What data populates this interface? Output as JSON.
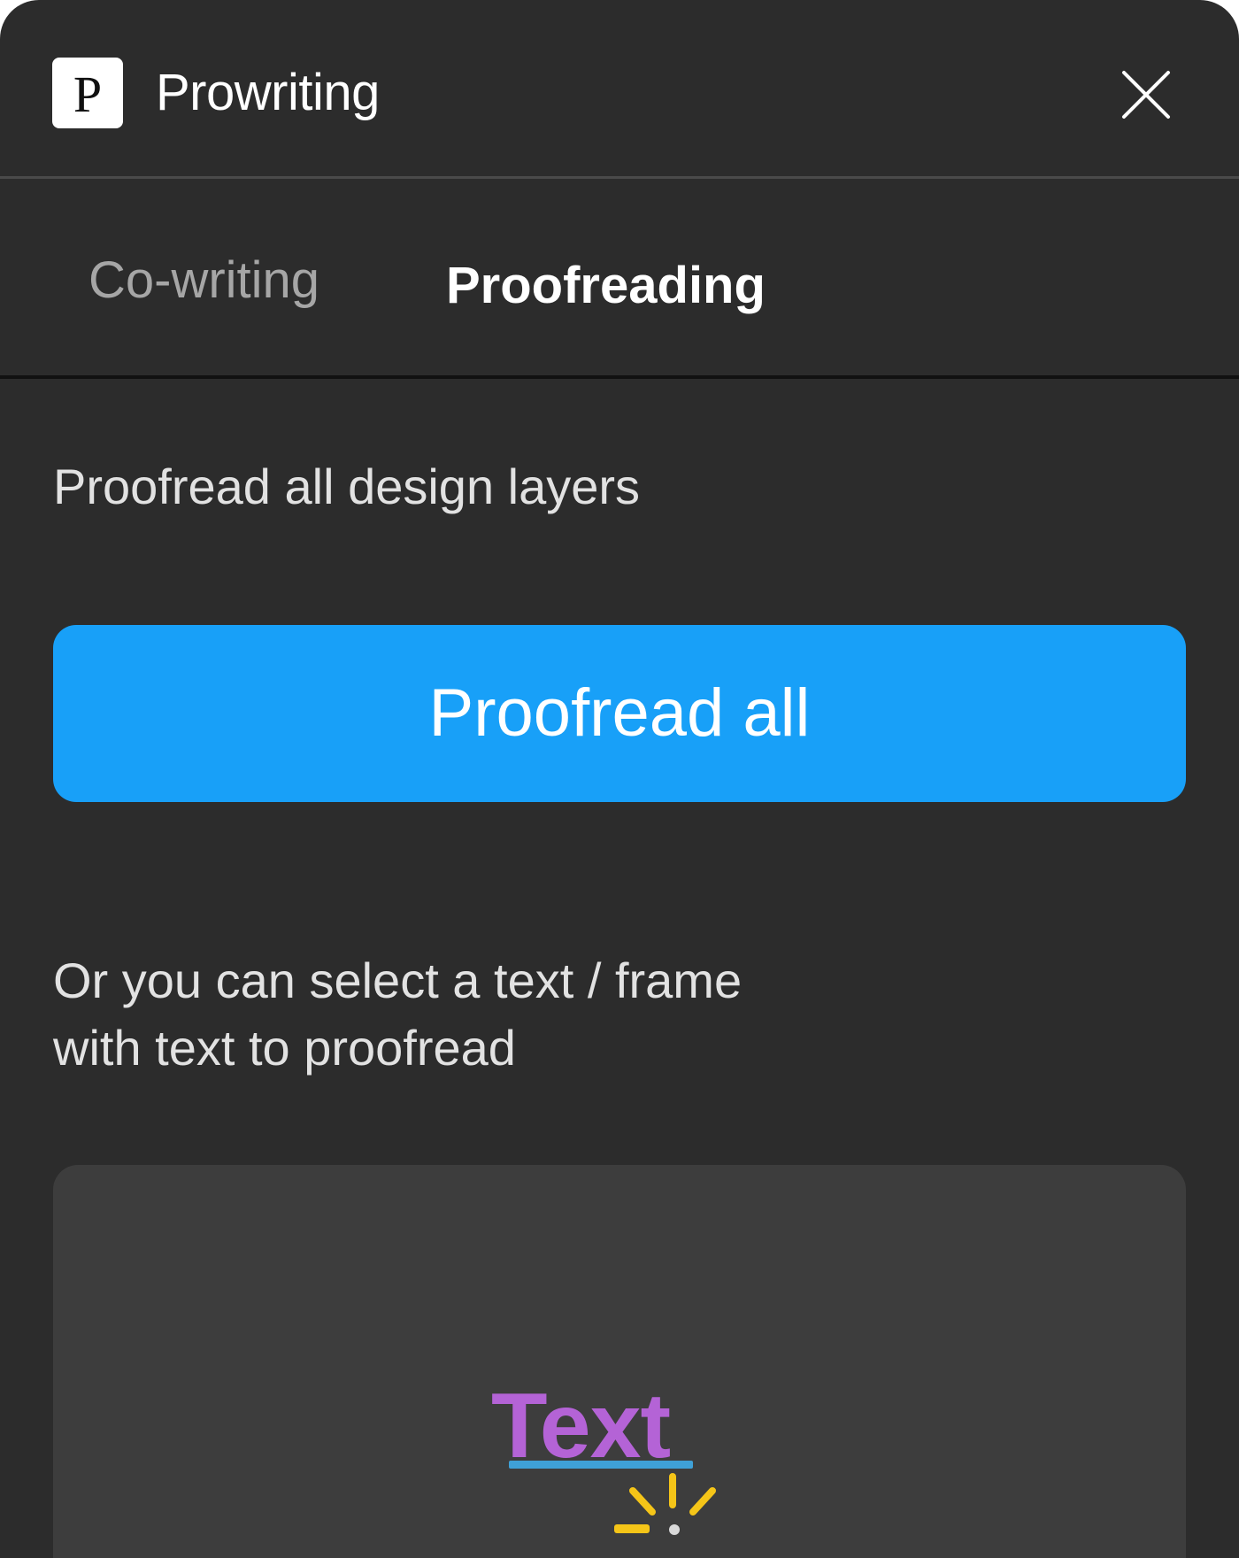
{
  "header": {
    "logo_letter": "P",
    "title": "Prowriting"
  },
  "tabs": [
    {
      "label": "Co-writing",
      "active": false
    },
    {
      "label": "Proofreading",
      "active": true
    }
  ],
  "proofreading": {
    "heading": "Proofread all design layers",
    "button_label": "Proofread all",
    "hint_line_1": "Or you can select a text / frame",
    "hint_line_2": "with text to proofread",
    "illustration_word": "Text"
  },
  "colors": {
    "background": "#2c2c2c",
    "accent": "#18a0f8",
    "illustration_text": "#b463d6",
    "illustration_underline": "#3fa0d6",
    "sparkle": "#f5c518"
  }
}
